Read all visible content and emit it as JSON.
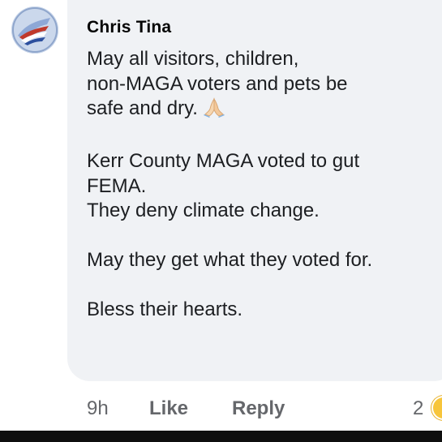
{
  "comment": {
    "author": "Chris Tina",
    "lines": [
      "May all visitors, children,",
      "non-MAGA voters and pets be",
      "safe and dry.",
      "",
      "Kerr County MAGA voted to gut",
      "FEMA.",
      "They deny climate change.",
      "",
      "May they get what they voted for.",
      "",
      "Bless their hearts."
    ],
    "emoji": "folded-hands-icon"
  },
  "actions": {
    "time": "9h",
    "like_label": "Like",
    "reply_label": "Reply",
    "reaction_count": "2"
  },
  "colors": {
    "bubble": "#f0f2f5",
    "text": "#1c1e21",
    "meta": "#65676b"
  }
}
